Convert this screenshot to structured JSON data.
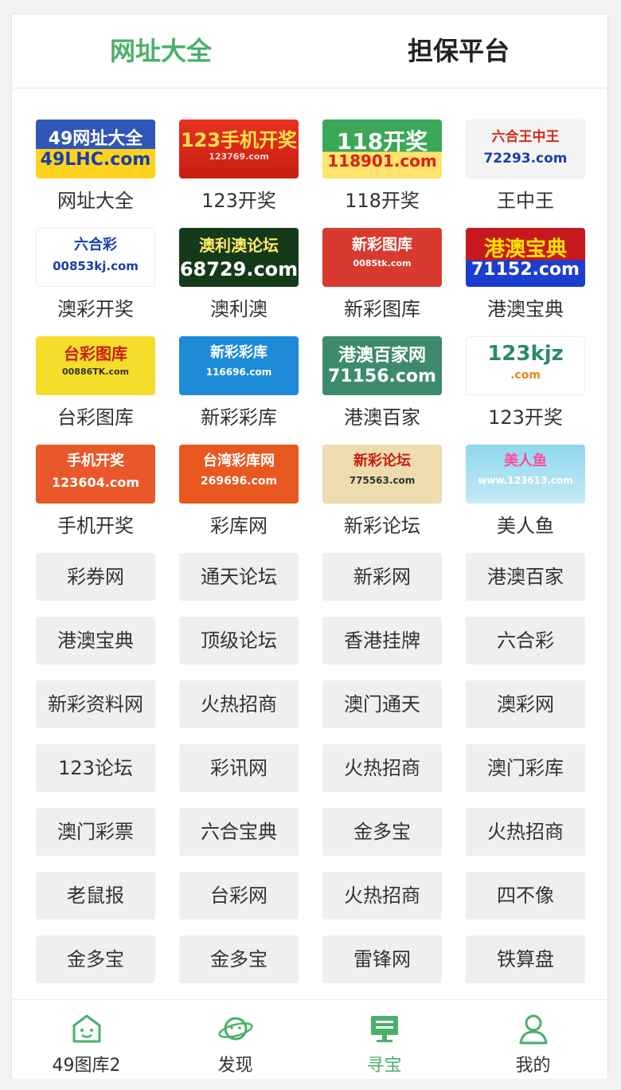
{
  "tabs": [
    {
      "label": "网址大全",
      "active": true
    },
    {
      "label": "担保平台",
      "active": false
    }
  ],
  "logos": [
    {
      "label": "网址大全",
      "line1": "49网址大全",
      "line2": "49LHC.com"
    },
    {
      "label": "123开奖",
      "line1": "123手机开奖",
      "line2": "123769.com"
    },
    {
      "label": "118开奖",
      "line1": "118开奖",
      "line2": "118901.com"
    },
    {
      "label": "王中王",
      "line1": "六合王中王",
      "line2": "72293.com"
    },
    {
      "label": "澳彩开奖",
      "line1": "六合彩",
      "line2": "00853kj.com"
    },
    {
      "label": "澳利澳",
      "line1": "澳利澳论坛",
      "line2": "68729.com"
    },
    {
      "label": "新彩图库",
      "line1": "新彩图库",
      "line2": "0085tk.com"
    },
    {
      "label": "港澳宝典",
      "line1": "港澳宝典",
      "line2": "71152.com"
    },
    {
      "label": "台彩图库",
      "line1": "台彩图库",
      "line2": "00886TK.com"
    },
    {
      "label": "新彩彩库",
      "line1": "新彩彩库",
      "line2": "116696.com"
    },
    {
      "label": "港澳百家",
      "line1": "港澳百家网",
      "line2": "71156.com"
    },
    {
      "label": "123开奖",
      "line1": "123kjz",
      "line2": ".com"
    },
    {
      "label": "手机开奖",
      "line1": "手机开奖",
      "line2": "123604.com"
    },
    {
      "label": "彩库网",
      "line1": "台湾彩库网",
      "line2": "269696.com"
    },
    {
      "label": "新彩论坛",
      "line1": "新彩论坛",
      "line2": "775563.com"
    },
    {
      "label": "美人鱼",
      "line1": "美人鱼",
      "line2": "www.123613.com"
    }
  ],
  "links": [
    "彩券网",
    "通天论坛",
    "新彩网",
    "港澳百家",
    "港澳宝典",
    "顶级论坛",
    "香港挂牌",
    "六合彩",
    "新彩资料网",
    "火热招商",
    "澳门通天",
    "澳彩网",
    "123论坛",
    "彩讯网",
    "火热招商",
    "澳门彩库",
    "澳门彩票",
    "六合宝典",
    "金多宝",
    "火热招商",
    "老鼠报",
    "台彩网",
    "火热招商",
    "四不像",
    "金多宝",
    "金多宝",
    "雷锋网",
    "铁算盘"
  ],
  "nav": [
    {
      "label": "49图库2",
      "icon": "home-icon",
      "active": false
    },
    {
      "label": "发现",
      "icon": "planet-icon",
      "active": false
    },
    {
      "label": "寻宝",
      "icon": "monitor-icon",
      "active": true
    },
    {
      "label": "我的",
      "icon": "user-icon",
      "active": false
    }
  ],
  "colors": {
    "accent": "#4ab06a",
    "text": "#333333",
    "button_bg": "#efefef"
  }
}
